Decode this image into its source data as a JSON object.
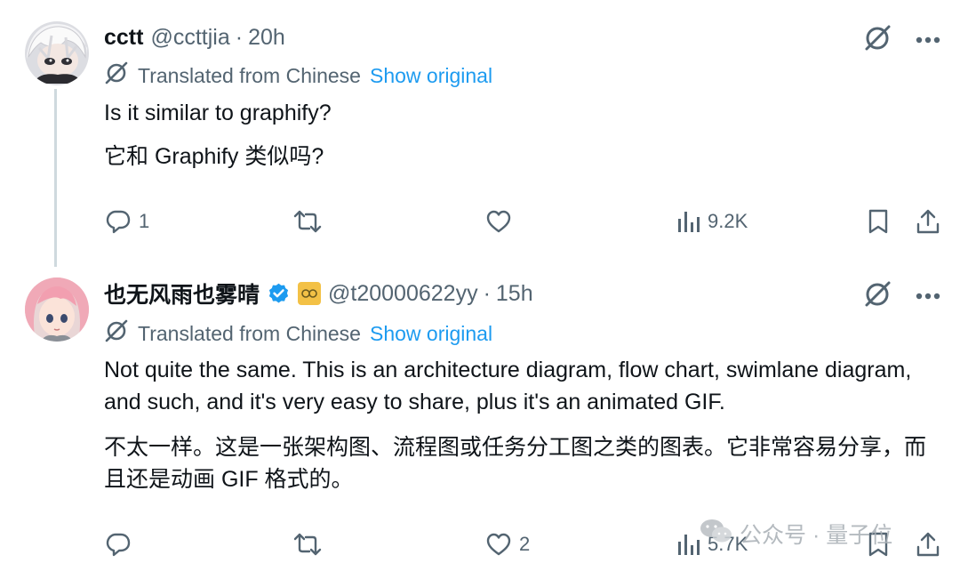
{
  "colors": {
    "text": "#0f1419",
    "secondary": "#536471",
    "link": "#1d9bf0",
    "thread_line": "#cfd9de",
    "verified": "#1d9bf0"
  },
  "tweets": [
    {
      "name": "cctt",
      "handle": "@ccttjia",
      "separator": "·",
      "time": "20h",
      "translated_label": "Translated from Chinese",
      "show_original": "Show original",
      "text_en": "Is it similar to graphify?",
      "text_zh": "它和 Graphify 类似吗?",
      "replies": "1",
      "retweets": "",
      "likes": "",
      "views": "9.2K",
      "icons": [
        "grok-icon",
        "more-icon",
        "translate-icon",
        "reply-icon",
        "retweet-icon",
        "like-icon",
        "views-icon",
        "bookmark-icon",
        "share-icon"
      ]
    },
    {
      "name": "也无风雨也雾晴",
      "handle": "@t20000622yy",
      "separator": "·",
      "time": "15h",
      "translated_label": "Translated from Chinese",
      "show_original": "Show original",
      "text_en": "Not quite the same. This is an architecture diagram, flow chart, swimlane diagram, and such, and it's very easy to share, plus it's an animated GIF.",
      "text_zh": "不太一样。这是一张架构图、流程图或任务分工图之类的图表。它非常容易分享，而且还是动画 GIF 格式的。",
      "replies": "",
      "retweets": "",
      "likes": "2",
      "views": "5.7K",
      "icons": [
        "verified-badge-icon",
        "affiliate-badge-icon",
        "grok-icon",
        "more-icon",
        "translate-icon",
        "reply-icon",
        "retweet-icon",
        "like-icon",
        "views-icon",
        "bookmark-icon",
        "share-icon"
      ]
    }
  ],
  "watermark": {
    "text": "公众号 · 量子位",
    "icon": "wechat-logo-icon"
  }
}
